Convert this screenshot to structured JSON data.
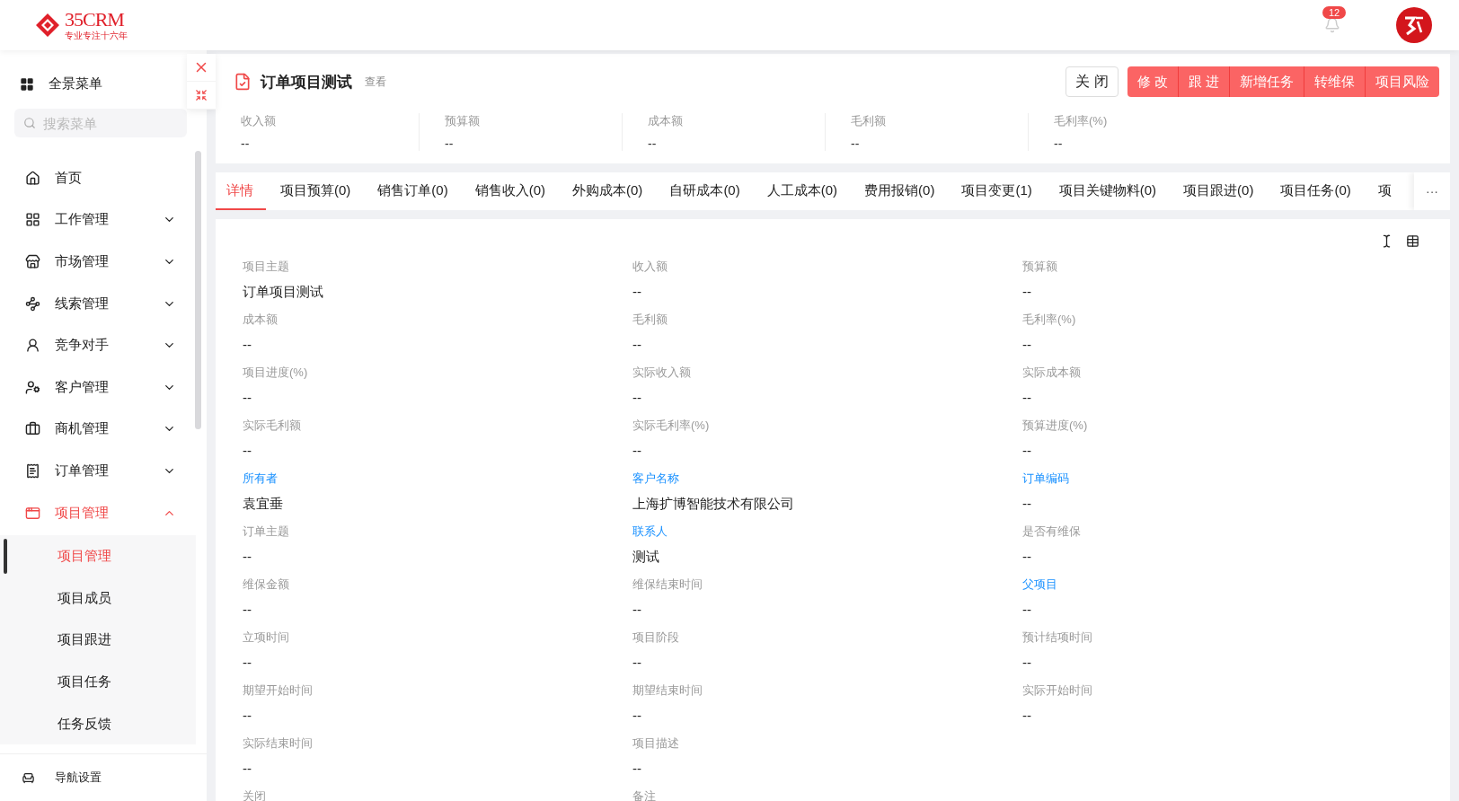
{
  "header": {
    "logo": {
      "name": "35CRM",
      "tagline": "专业专注十六年"
    },
    "notification_count": "12"
  },
  "sidebar": {
    "menu_title": "全景菜单",
    "search": {
      "placeholder": "搜索菜单"
    },
    "items": [
      {
        "label": "首页",
        "expandable": false,
        "expanded": false,
        "selected": false
      },
      {
        "label": "工作管理",
        "expandable": true,
        "expanded": false,
        "selected": false
      },
      {
        "label": "市场管理",
        "expandable": true,
        "expanded": false,
        "selected": false
      },
      {
        "label": "线索管理",
        "expandable": true,
        "expanded": false,
        "selected": false
      },
      {
        "label": "竞争对手",
        "expandable": true,
        "expanded": false,
        "selected": false
      },
      {
        "label": "客户管理",
        "expandable": true,
        "expanded": false,
        "selected": false
      },
      {
        "label": "商机管理",
        "expandable": true,
        "expanded": false,
        "selected": false
      },
      {
        "label": "订单管理",
        "expandable": true,
        "expanded": false,
        "selected": false
      },
      {
        "label": "项目管理",
        "expandable": true,
        "expanded": true,
        "selected": true,
        "children": [
          {
            "label": "项目管理",
            "selected": true
          },
          {
            "label": "项目成员",
            "selected": false
          },
          {
            "label": "项目跟进",
            "selected": false
          },
          {
            "label": "项目任务",
            "selected": false
          },
          {
            "label": "任务反馈",
            "selected": false
          }
        ]
      }
    ],
    "footer": "导航设置"
  },
  "page": {
    "title": "订单项目测试",
    "mode": "查看",
    "close_button": "关 闭",
    "actions": [
      "修 改",
      "跟 进",
      "新增任务",
      "转维保",
      "项目风险"
    ],
    "stats": [
      {
        "label": "收入额",
        "value": "--"
      },
      {
        "label": "预算额",
        "value": "--"
      },
      {
        "label": "成本额",
        "value": "--"
      },
      {
        "label": "毛利额",
        "value": "--"
      },
      {
        "label": "毛利率(%)",
        "value": "--"
      }
    ],
    "tabs": [
      {
        "label": "详情",
        "selected": true
      },
      {
        "label": "项目预算(0)",
        "selected": false
      },
      {
        "label": "销售订单(0)",
        "selected": false
      },
      {
        "label": "销售收入(0)",
        "selected": false
      },
      {
        "label": "外购成本(0)",
        "selected": false
      },
      {
        "label": "自研成本(0)",
        "selected": false
      },
      {
        "label": "人工成本(0)",
        "selected": false
      },
      {
        "label": "费用报销(0)",
        "selected": false
      },
      {
        "label": "项目变更(1)",
        "selected": false
      },
      {
        "label": "项目关键物料(0)",
        "selected": false
      },
      {
        "label": "项目跟进(0)",
        "selected": false
      },
      {
        "label": "项目任务(0)",
        "selected": false
      },
      {
        "label": "项",
        "selected": false
      }
    ],
    "tabs_more": "···",
    "field_rows": [
      [
        {
          "label": "项目主题",
          "value": "订单项目测试",
          "link": false
        },
        {
          "label": "收入额",
          "value": "--",
          "link": false
        },
        {
          "label": "预算额",
          "value": "--",
          "link": false
        }
      ],
      [
        {
          "label": "成本额",
          "value": "--",
          "link": false
        },
        {
          "label": "毛利额",
          "value": "--",
          "link": false
        },
        {
          "label": "毛利率(%)",
          "value": "--",
          "link": false
        }
      ],
      [
        {
          "label": "项目进度(%)",
          "value": "--",
          "link": false
        },
        {
          "label": "实际收入额",
          "value": "--",
          "link": false
        },
        {
          "label": "实际成本额",
          "value": "--",
          "link": false
        }
      ],
      [
        {
          "label": "实际毛利额",
          "value": "--",
          "link": false
        },
        {
          "label": "实际毛利率(%)",
          "value": "--",
          "link": false
        },
        {
          "label": "预算进度(%)",
          "value": "--",
          "link": false
        }
      ],
      [
        {
          "label": "所有者",
          "value": "袁宜垂",
          "link": true
        },
        {
          "label": "客户名称",
          "value": "上海扩博智能技术有限公司",
          "link": true
        },
        {
          "label": "订单编码",
          "value": "--",
          "link": true
        }
      ],
      [
        {
          "label": "订单主题",
          "value": "--",
          "link": false
        },
        {
          "label": "联系人",
          "value": "测试",
          "link": true
        },
        {
          "label": "是否有维保",
          "value": "--",
          "link": false
        }
      ],
      [
        {
          "label": "维保金额",
          "value": "--",
          "link": false
        },
        {
          "label": "维保结束时间",
          "value": "--",
          "link": false
        },
        {
          "label": "父项目",
          "value": "--",
          "link": true
        }
      ],
      [
        {
          "label": "立项时间",
          "value": "--",
          "link": false
        },
        {
          "label": "项目阶段",
          "value": "--",
          "link": false
        },
        {
          "label": "预计结项时间",
          "value": "--",
          "link": false
        }
      ],
      [
        {
          "label": "期望开始时间",
          "value": "--",
          "link": false
        },
        {
          "label": "期望结束时间",
          "value": "--",
          "link": false
        },
        {
          "label": "实际开始时间",
          "value": "--",
          "link": false
        }
      ],
      [
        {
          "label": "实际结束时间",
          "value": "--",
          "link": false
        },
        {
          "label": "项目描述",
          "value": "--",
          "link": false
        }
      ],
      [
        {
          "label": "关闭",
          "link": false
        },
        {
          "label": "备注",
          "link": false
        }
      ]
    ]
  }
}
